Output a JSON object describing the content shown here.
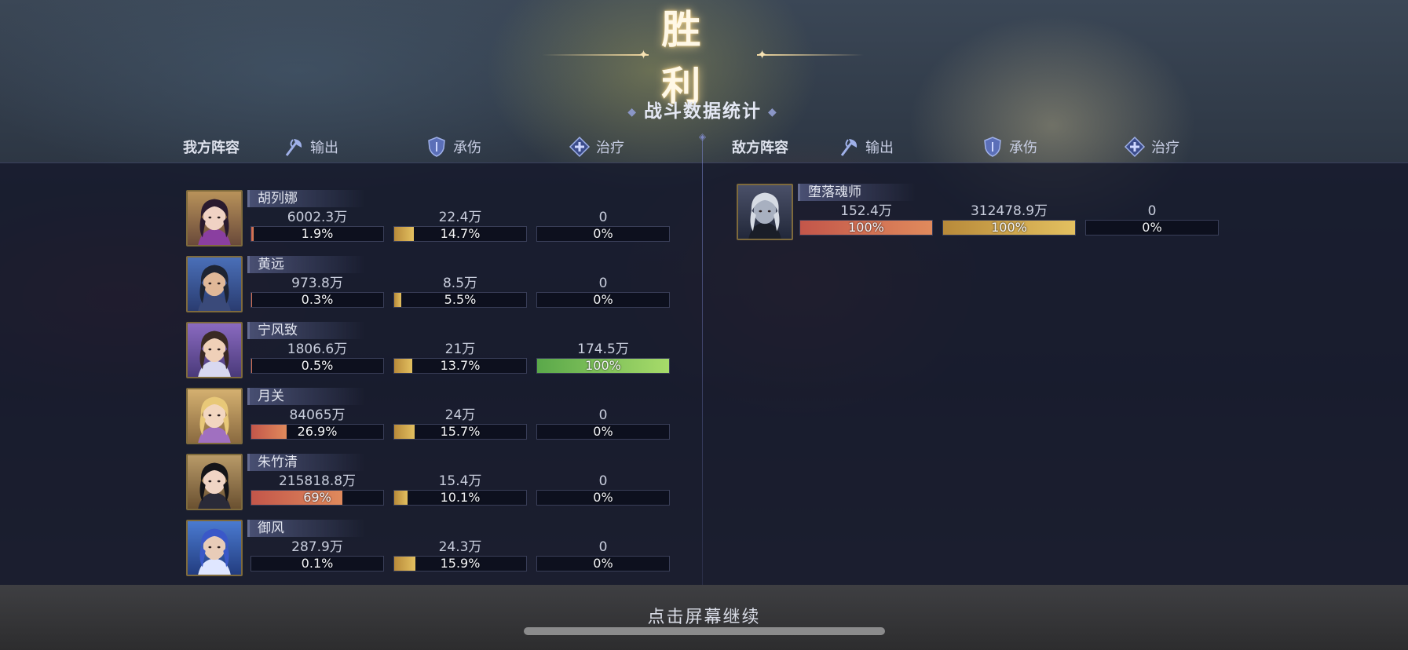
{
  "title": "胜利",
  "subtitle": "战斗数据统计",
  "continue_text": "点击屏幕继续",
  "stat_labels": {
    "output": "输出",
    "tank": "承伤",
    "heal": "治疗"
  },
  "our_team": {
    "label": "我方阵容",
    "heroes": [
      {
        "name": "胡列娜",
        "output": "6002.3万",
        "output_pct": "1.9%",
        "output_fill": 1.9,
        "tank": "22.4万",
        "tank_pct": "14.7%",
        "tank_fill": 14.7,
        "heal": "0",
        "heal_pct": "0%",
        "heal_fill": 0,
        "portrait": "hu-lie-na"
      },
      {
        "name": "黄远",
        "output": "973.8万",
        "output_pct": "0.3%",
        "output_fill": 0.3,
        "tank": "8.5万",
        "tank_pct": "5.5%",
        "tank_fill": 5.5,
        "heal": "0",
        "heal_pct": "0%",
        "heal_fill": 0,
        "portrait": "huang-yuan"
      },
      {
        "name": "宁风致",
        "output": "1806.6万",
        "output_pct": "0.5%",
        "output_fill": 0.5,
        "tank": "21万",
        "tank_pct": "13.7%",
        "tank_fill": 13.7,
        "heal": "174.5万",
        "heal_pct": "100%",
        "heal_fill": 100,
        "portrait": "ning-feng-zhi"
      },
      {
        "name": "月关",
        "output": "84065万",
        "output_pct": "26.9%",
        "output_fill": 26.9,
        "tank": "24万",
        "tank_pct": "15.7%",
        "tank_fill": 15.7,
        "heal": "0",
        "heal_pct": "0%",
        "heal_fill": 0,
        "portrait": "yue-guan"
      },
      {
        "name": "朱竹清",
        "output": "215818.8万",
        "output_pct": "69%",
        "output_fill": 69,
        "tank": "15.4万",
        "tank_pct": "10.1%",
        "tank_fill": 10.1,
        "heal": "0",
        "heal_pct": "0%",
        "heal_fill": 0,
        "portrait": "zhu-zhu-qing"
      },
      {
        "name": "御风",
        "output": "287.9万",
        "output_pct": "0.1%",
        "output_fill": 0.1,
        "tank": "24.3万",
        "tank_pct": "15.9%",
        "tank_fill": 15.9,
        "heal": "0",
        "heal_pct": "0%",
        "heal_fill": 0,
        "portrait": "yu-feng"
      }
    ]
  },
  "enemy_team": {
    "label": "敌方阵容",
    "heroes": [
      {
        "name": "堕落魂师",
        "output": "152.4万",
        "output_pct": "100%",
        "output_fill": 100,
        "tank": "312478.9万",
        "tank_pct": "100%",
        "tank_fill": 100,
        "heal": "0",
        "heal_pct": "0%",
        "heal_fill": 0,
        "portrait": "fallen-soul-master"
      }
    ]
  },
  "colors": {
    "output_bar": "#d56a50",
    "tank_bar": "#d4a84c",
    "heal_bar": "#8cc85a",
    "title_glow": "#f3d9a0"
  }
}
